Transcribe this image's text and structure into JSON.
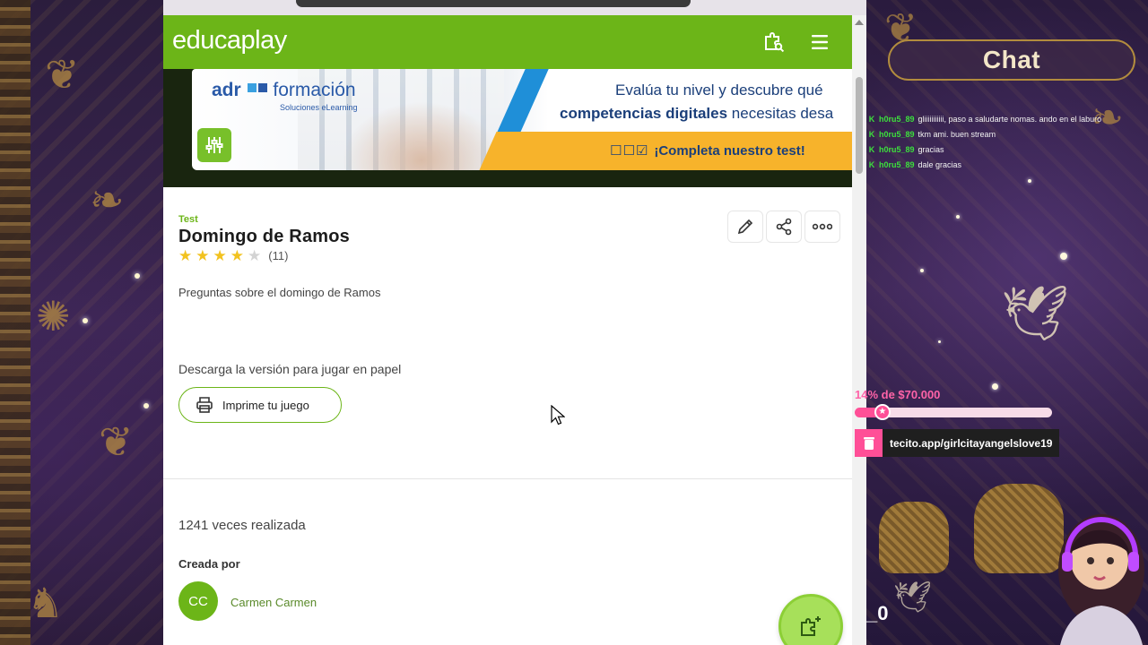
{
  "browser": {
    "tab_strip": ""
  },
  "header": {
    "logo": "educaplay",
    "icons": [
      "puzzle-search-icon",
      "hamburger-menu-icon"
    ]
  },
  "ad": {
    "brand_a": "adr",
    "brand_b": "formación",
    "brand_sub": "Soluciones eLearning",
    "line1": "Evalúa tu nivel y descubre qué",
    "line2_bold": "competencias digitales",
    "line2_rest": " necesitas desa",
    "cta_boxes": "☐☐☑",
    "cta": "¡Completa nuestro test!"
  },
  "activity": {
    "kind": "Test",
    "title": "Domingo de Ramos",
    "rating": 4,
    "rating_max": 5,
    "rating_count": "(11)",
    "description": "Preguntas sobre el domingo de Ramos",
    "download_text": "Descarga la versión para jugar en papel",
    "print_button": "Imprime tu juego",
    "played": "1241 veces realizada",
    "created_by_label": "Creada por",
    "author_initials": "CC",
    "author_name": "Carmen Carmen"
  },
  "actions": [
    "edit-icon",
    "share-icon",
    "more-icon"
  ],
  "chat": {
    "title": "Chat",
    "messages": [
      {
        "badge": "K",
        "user": "h0ru5_89",
        "text": "gliiiiiiiiiii, paso a saludarte nomas. ando en el laburo"
      },
      {
        "badge": "K",
        "user": "h0ru5_89",
        "text": "tkm ami. buen stream"
      },
      {
        "badge": "K",
        "user": "h0ru5_89",
        "text": "gracias"
      },
      {
        "badge": "K",
        "user": "h0ru5_89",
        "text": "dale gracias"
      }
    ]
  },
  "goal": {
    "text": "14% de $70.000",
    "progress": 0.14
  },
  "tecito": {
    "url_prefix": "tecito.app/",
    "url_user": "girlcitayangelslove19"
  },
  "overlay_counter": "_0",
  "colors": {
    "brand_green": "#6cb518",
    "goal_pink": "#ff4f97",
    "chat_green": "#3ce03c"
  }
}
